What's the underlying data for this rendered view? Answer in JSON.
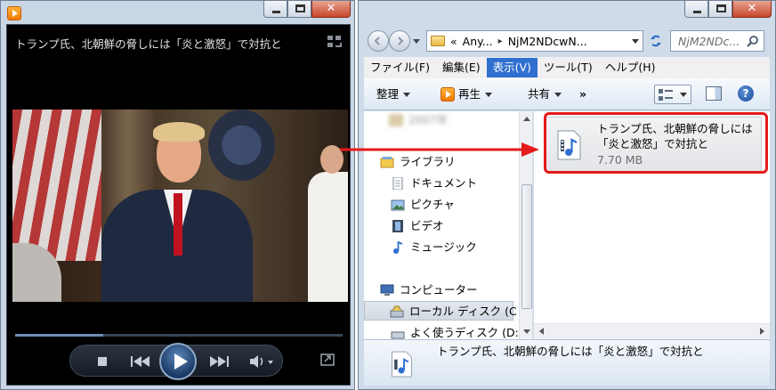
{
  "player": {
    "now_playing": "トランプ氏、北朝鮮の脅しには「炎と激怒」で対抗と",
    "seek_progress": 0.27,
    "accent_color": "#6d8eb4",
    "caption_close": "✕"
  },
  "explorer": {
    "caption_close": "✕",
    "address": {
      "prefix": "«",
      "seg1": "Any...",
      "chevron": "▸",
      "seg2": "NjM2NDcwN..."
    },
    "search_placeholder": "NjM2NDc...",
    "menu": [
      "ファイル(F)",
      "編集(E)",
      "表示(V)",
      "ツール(T)",
      "ヘルプ(H)"
    ],
    "active_menu_index": 2,
    "toolbar": {
      "organize": "整理",
      "play": "再生",
      "share": "共有",
      "more": "»",
      "help": "?"
    },
    "nav": {
      "blurred_top": "2007年",
      "library": "ライブラリ",
      "documents": "ドキュメント",
      "pictures": "ピクチャ",
      "videos": "ビデオ",
      "music": "ミュージック",
      "computer": "コンピューター",
      "local_disk": "ローカル ディスク (C",
      "frequent_disk": "よく使うディスク (D:"
    },
    "file": {
      "name": "トランプ氏、北朝鮮の脅しには「炎と激怒」で対抗と",
      "size": "7.70 MB"
    },
    "details": {
      "name": "トランプ氏、北朝鮮の脅しには「炎と激怒」で対抗と"
    }
  },
  "annotation": {
    "color": "#e51a1a"
  }
}
